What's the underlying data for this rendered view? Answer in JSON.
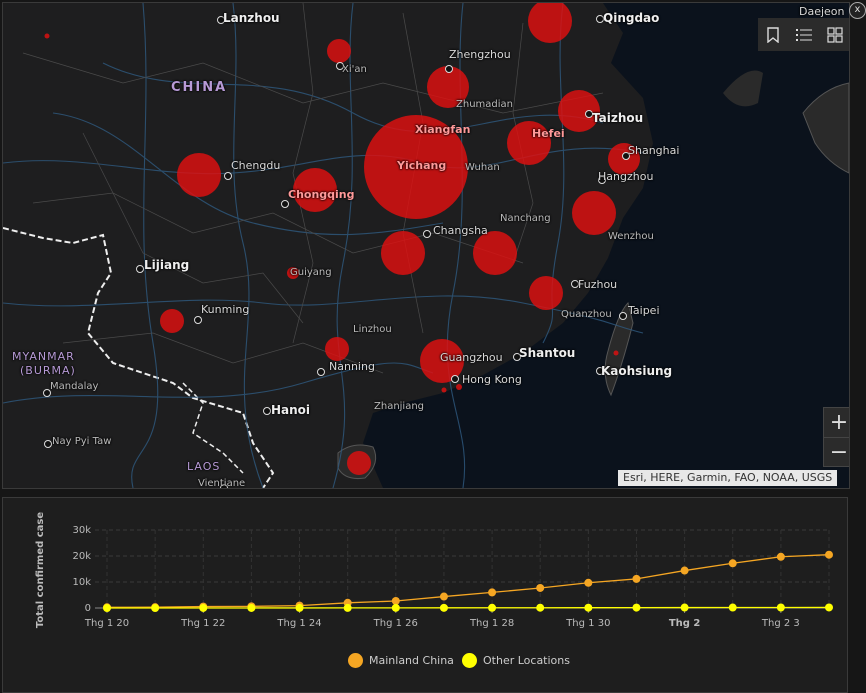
{
  "map": {
    "labels": {
      "lanzhou": "Lanzhou",
      "qingdao": "Qingdao",
      "daejeon": "Daejeon",
      "china": "CHINA",
      "xian": "Xi'an",
      "zhengzhou": "Zhengzhou",
      "zhumadian": "Zhumadian",
      "xiangfan": "Xiangfan",
      "hefei": "Hefei",
      "taizhou": "Taizhou",
      "shanghai": "Shanghai",
      "chengdu": "Chengdu",
      "yichang": "Yichang",
      "wuhan": "Wuhan",
      "chongqing": "Chongqing",
      "hangzhou": "Hangzhou",
      "nanchang": "Nanchang",
      "changsha": "Changsha",
      "wenzhou": "Wenzhou",
      "lijiang": "Lijiang",
      "guiyang": "Guiyang",
      "fuzhou": "Fuzhou",
      "kunming": "Kunming",
      "taipei": "Taipei",
      "quanzhou": "Quanzhou",
      "linzhou": "Linzhou",
      "myanmar": "MYANMAR",
      "burma": "(BURMA)",
      "guangzhou": "Guangzhou",
      "shantou": "Shantou",
      "nanning": "Nanning",
      "mandalay": "Mandalay",
      "hongkong": "Hong Kong",
      "kaohsiung": "Kaohsiung",
      "hanoi": "Hanoi",
      "zhanjiang": "Zhanjiang",
      "naypyitaw": "Nay Pyi Taw",
      "laos": "LAOS",
      "vientiane": "Vientiane"
    },
    "attribution": "Esri, HERE, Garmin, FAO, NOAA, USGS",
    "toolbar": {
      "bookmark_icon": "bookmark-icon",
      "legend_icon": "list-icon",
      "basemap_icon": "basemap-gallery-icon"
    },
    "zoom_in": "+",
    "zoom_out": "−",
    "close_icon": "x"
  },
  "chart_data": {
    "type": "line",
    "ylabel": "Total confirmed case",
    "yticks": [
      "0",
      "10k",
      "20k",
      "30k"
    ],
    "ylim": [
      0,
      30000
    ],
    "x_tick_labels": [
      "Thg 1 20",
      "Thg 1 22",
      "Thg 1 24",
      "Thg 1 26",
      "Thg 1 28",
      "Thg 1 30",
      "Thg 2",
      "Thg 2 3"
    ],
    "x": [
      "Thg 1 20",
      "Thg 1 21",
      "Thg 1 22",
      "Thg 1 23",
      "Thg 1 24",
      "Thg 1 25",
      "Thg 1 26",
      "Thg 1 27",
      "Thg 1 28",
      "Thg 1 29",
      "Thg 1 30",
      "Thg 1 31",
      "Thg 2",
      "Thg 2 2",
      "Thg 2 3",
      "Thg 2 4"
    ],
    "series": [
      {
        "name": "Mainland China",
        "color": "#f5a623",
        "values": [
          278,
          326,
          547,
          639,
          916,
          2000,
          2700,
          4400,
          6000,
          7700,
          9700,
          11200,
          14400,
          17200,
          19700,
          20500
        ]
      },
      {
        "name": "Other Locations",
        "color": "#ffff00",
        "values": [
          4,
          6,
          8,
          14,
          25,
          40,
          57,
          64,
          87,
          105,
          118,
          153,
          173,
          183,
          188,
          212
        ]
      }
    ],
    "grid": true,
    "legend": "bottom-center"
  }
}
